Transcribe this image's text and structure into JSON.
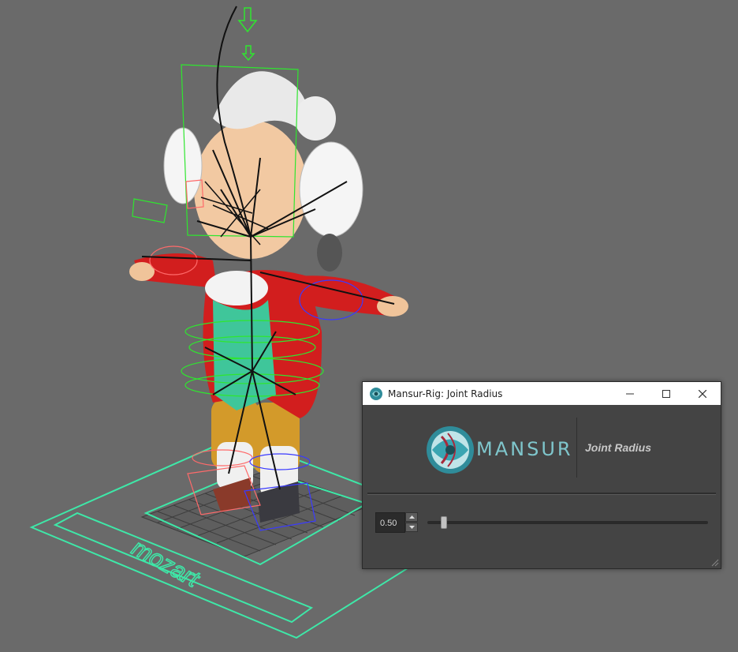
{
  "scene": {
    "asset_label": "mozart",
    "colors": {
      "background": "#6a6a6a",
      "grid": "#3a3a3a",
      "ground_ctrl": "#3ee8a8",
      "green_ctrl": "#2fe62f",
      "red_ctrl": "#ff6a6a",
      "blue_ctrl": "#3a3aff"
    }
  },
  "dialog": {
    "title": "Mansur-Rig: Joint Radius",
    "icons": {
      "app": "mansur-logo-icon",
      "minimize": "minimize-icon",
      "maximize": "maximize-icon",
      "close": "close-icon",
      "resize": "resize-grip-icon"
    },
    "banner": {
      "logo_text": "MANSUR",
      "subtitle": "Joint Radius"
    },
    "radius": {
      "value": "0.50",
      "slider_position": 0.06
    },
    "colors": {
      "panel": "#444444",
      "logo": "#7fc6cc"
    }
  }
}
